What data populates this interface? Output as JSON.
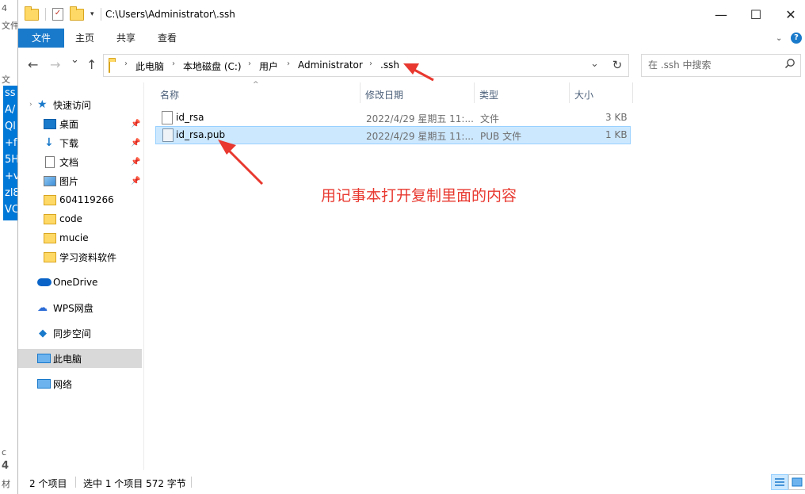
{
  "window": {
    "title": "C:\\Users\\Administrator\\.ssh",
    "minimize": "—",
    "maximize": "☐",
    "close": "✕"
  },
  "background_window": {
    "fragments": [
      "4",
      "文件(",
      "文",
      "c",
      "4",
      "材"
    ],
    "selected_fragments": [
      "ss",
      "A/",
      "Ql",
      "+f",
      "5H",
      "+v",
      "zl8",
      "VC"
    ]
  },
  "ribbon": {
    "tabs": [
      "文件",
      "主页",
      "共享",
      "查看"
    ]
  },
  "nav": {
    "back": "←",
    "forward": "→",
    "recent": "⌄",
    "up": "↑",
    "breadcrumb": [
      "此电脑",
      "本地磁盘 (C:)",
      "用户",
      "Administrator",
      ".ssh"
    ],
    "search_placeholder": "在 .ssh 中搜索"
  },
  "sidebar": {
    "items": [
      {
        "label": "快速访问",
        "icon": "star-icon"
      },
      {
        "label": "桌面",
        "icon": "desktop-icon",
        "pinned": true
      },
      {
        "label": "下载",
        "icon": "download-icon",
        "pinned": true
      },
      {
        "label": "文档",
        "icon": "document-icon",
        "pinned": true
      },
      {
        "label": "图片",
        "icon": "pictures-icon",
        "pinned": true
      },
      {
        "label": "604119266",
        "icon": "folder-icon"
      },
      {
        "label": "code",
        "icon": "folder-icon"
      },
      {
        "label": "mucie",
        "icon": "folder-icon"
      },
      {
        "label": "学习资料软件",
        "icon": "folder-icon"
      },
      {
        "label": "OneDrive",
        "icon": "onedrive-icon"
      },
      {
        "label": "WPS网盘",
        "icon": "wps-cloud-icon"
      },
      {
        "label": "同步空间",
        "icon": "sync-icon"
      },
      {
        "label": "此电脑",
        "icon": "this-pc-icon",
        "selected": true
      },
      {
        "label": "网络",
        "icon": "network-icon"
      }
    ]
  },
  "files": {
    "columns": [
      "名称",
      "修改日期",
      "类型",
      "大小"
    ],
    "rows": [
      {
        "name": "id_rsa",
        "modified": "2022/4/29 星期五 11:...",
        "type": "文件",
        "size": "3 KB"
      },
      {
        "name": "id_rsa.pub",
        "modified": "2022/4/29 星期五 11:...",
        "type": "PUB 文件",
        "size": "1 KB",
        "selected": true
      }
    ]
  },
  "annotation": {
    "text": "用记事本打开复制里面的内容",
    "color": "#e8382f"
  },
  "status": {
    "count": "2 个项目",
    "selection": "选中 1 个项目  572 字节"
  },
  "colors": {
    "accent": "#1979ca",
    "selection": "#cce8ff"
  }
}
